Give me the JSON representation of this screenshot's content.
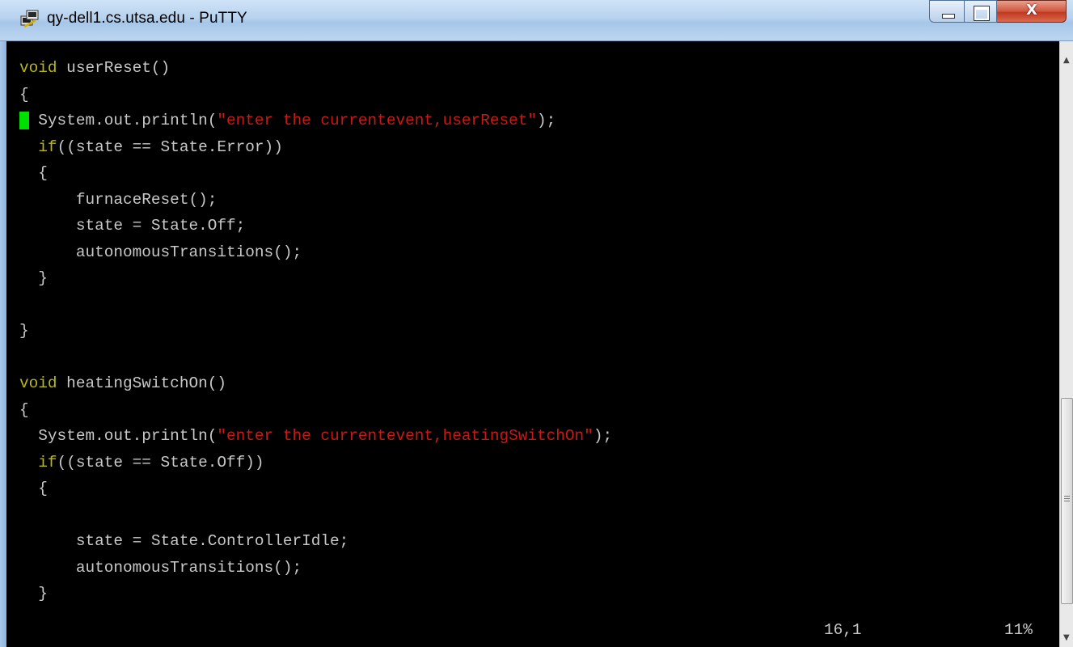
{
  "window": {
    "title": "qy-dell1.cs.utsa.edu - PuTTY",
    "icon": "putty-icon",
    "controls": {
      "minimize_icon": "minimize-icon",
      "maximize_icon": "maximize-icon",
      "close_label": "X"
    }
  },
  "editor": {
    "colors": {
      "background": "#000000",
      "text": "#c8c8c8",
      "keyword": "#b7b718",
      "string": "#c81a14",
      "cursor": "#00e000"
    },
    "lines": [
      [
        {
          "t": "kw",
          "v": "void"
        },
        {
          "t": "n",
          "v": " userReset()"
        }
      ],
      [
        {
          "t": "n",
          "v": "{"
        }
      ],
      [
        {
          "t": "cursor",
          "v": " "
        },
        {
          "t": "n",
          "v": " System.out.println("
        },
        {
          "t": "str",
          "v": "\"enter the currentevent,userReset\""
        },
        {
          "t": "n",
          "v": ");"
        }
      ],
      [
        {
          "t": "n",
          "v": "  "
        },
        {
          "t": "kw",
          "v": "if"
        },
        {
          "t": "n",
          "v": "((state == State.Error))"
        }
      ],
      [
        {
          "t": "n",
          "v": "  {"
        }
      ],
      [
        {
          "t": "n",
          "v": "      furnaceReset();"
        }
      ],
      [
        {
          "t": "n",
          "v": "      state = State.Off;"
        }
      ],
      [
        {
          "t": "n",
          "v": "      autonomousTransitions();"
        }
      ],
      [
        {
          "t": "n",
          "v": "  }"
        }
      ],
      [
        {
          "t": "n",
          "v": ""
        }
      ],
      [
        {
          "t": "n",
          "v": "}"
        }
      ],
      [
        {
          "t": "n",
          "v": ""
        }
      ],
      [
        {
          "t": "kw",
          "v": "void"
        },
        {
          "t": "n",
          "v": " heatingSwitchOn()"
        }
      ],
      [
        {
          "t": "n",
          "v": "{"
        }
      ],
      [
        {
          "t": "n",
          "v": "  System.out.println("
        },
        {
          "t": "str",
          "v": "\"enter the currentevent,heatingSwitchOn\""
        },
        {
          "t": "n",
          "v": ");"
        }
      ],
      [
        {
          "t": "n",
          "v": "  "
        },
        {
          "t": "kw",
          "v": "if"
        },
        {
          "t": "n",
          "v": "((state == State.Off))"
        }
      ],
      [
        {
          "t": "n",
          "v": "  {"
        }
      ],
      [
        {
          "t": "n",
          "v": ""
        }
      ],
      [
        {
          "t": "n",
          "v": "      state = State.ControllerIdle;"
        }
      ],
      [
        {
          "t": "n",
          "v": "      autonomousTransitions();"
        }
      ],
      [
        {
          "t": "n",
          "v": "  }"
        }
      ]
    ]
  },
  "status": {
    "position": "16,1",
    "percent": "11%"
  },
  "scrollbar": {
    "up_icon": "scroll-up-arrow-icon",
    "down_icon": "scroll-down-arrow-icon",
    "thumb_position_fraction": 0.55
  }
}
